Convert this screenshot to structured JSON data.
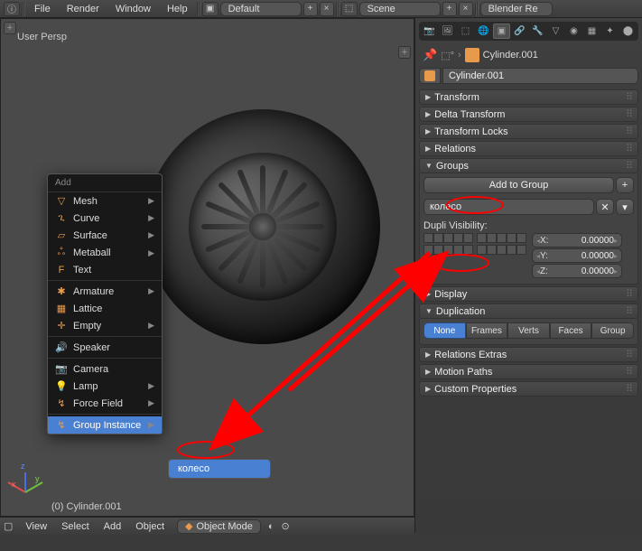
{
  "top_menu": {
    "items": [
      "File",
      "Render",
      "Window",
      "Help"
    ],
    "layout": "Default",
    "scene_label": "Scene",
    "engine": "Blender Re"
  },
  "viewport": {
    "persp_label": "User Persp",
    "object_name": "(0) Cylinder.001"
  },
  "vp_header": {
    "items": [
      "View",
      "Select",
      "Add",
      "Object"
    ],
    "mode": "Object Mode"
  },
  "add_menu": {
    "title": "Add",
    "items": [
      {
        "icon": "▽",
        "label": "Mesh",
        "sub": true
      },
      {
        "icon": "ጊ",
        "label": "Curve",
        "sub": true
      },
      {
        "icon": "▱",
        "label": "Surface",
        "sub": true
      },
      {
        "icon": "ஃ",
        "label": "Metaball",
        "sub": true
      },
      {
        "icon": "F",
        "label": "Text",
        "sub": false
      }
    ],
    "items2": [
      {
        "icon": "✱",
        "label": "Armature",
        "sub": true
      },
      {
        "icon": "▦",
        "label": "Lattice",
        "sub": false
      },
      {
        "icon": "✛",
        "label": "Empty",
        "sub": true
      }
    ],
    "items3": [
      {
        "icon": "🔊",
        "label": "Speaker",
        "sub": false
      }
    ],
    "items4": [
      {
        "icon": "📷",
        "label": "Camera",
        "sub": false
      },
      {
        "icon": "💡",
        "label": "Lamp",
        "sub": true
      },
      {
        "icon": "↯",
        "label": "Force Field",
        "sub": true
      }
    ],
    "items5": [
      {
        "icon": "↯",
        "label": "Group Instance",
        "sub": true
      }
    ],
    "submenu_item": "колесо"
  },
  "properties": {
    "breadcrumb_obj": "Cylinder.001",
    "name_field": "Cylinder.001",
    "panels_collapsed": [
      "Transform",
      "Delta Transform",
      "Transform Locks",
      "Relations"
    ],
    "groups": {
      "title": "Groups",
      "add_label": "Add to Group",
      "group_name": "колесо",
      "dupli_label": "Dupli Visibility:",
      "coords": [
        {
          "axis": "X:",
          "val": "0.00000"
        },
        {
          "axis": "Y:",
          "val": "0.00000"
        },
        {
          "axis": "Z:",
          "val": "0.00000"
        }
      ]
    },
    "display": {
      "title": "Display"
    },
    "duplication": {
      "title": "Duplication",
      "options": [
        "None",
        "Frames",
        "Verts",
        "Faces",
        "Group"
      ]
    },
    "panels_after": [
      "Relations Extras",
      "Motion Paths",
      "Custom Properties"
    ]
  }
}
